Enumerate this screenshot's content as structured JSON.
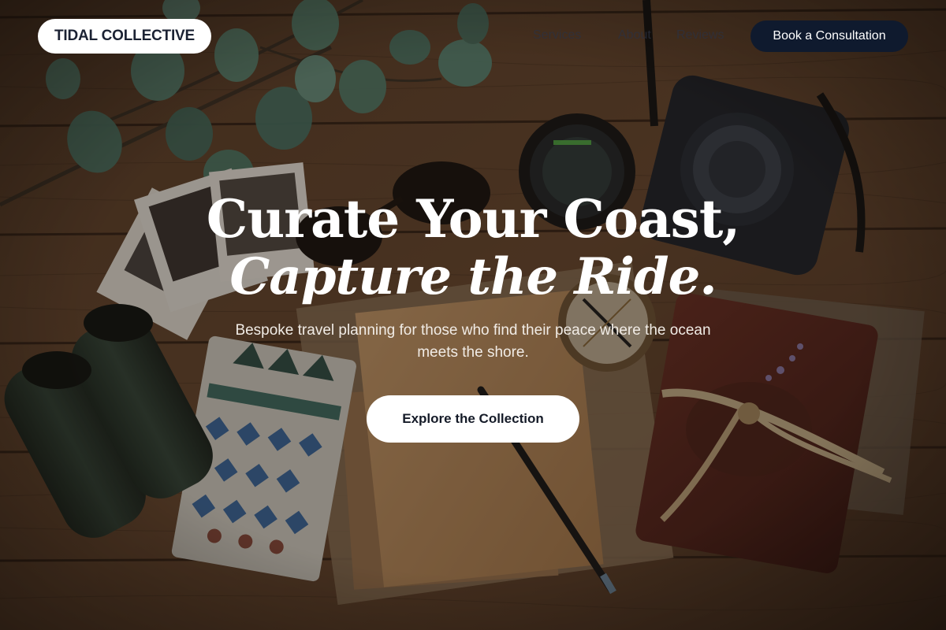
{
  "nav": {
    "logo": "TIDAL COLLECTIVE",
    "links": [
      "Services",
      "About",
      "Reviews"
    ],
    "cta_label": "Book a Consultation"
  },
  "hero": {
    "headline_line1": "Curate Your Coast,",
    "headline_line2": "Capture the Ride.",
    "subtitle": "Bespoke travel planning for those who find their peace where the ocean meets the shore.",
    "cta_label": "Explore the Collection"
  },
  "colors": {
    "nav_cta_bg": "#0f1a2e",
    "pill_bg": "#ffffff",
    "headline": "#ffffff",
    "wood": "#4a3322"
  },
  "background": {
    "icons": [
      "eucalyptus-leaves",
      "instant-photos",
      "sunglasses",
      "camera-lens",
      "mirrorless-camera",
      "compass",
      "binoculars",
      "patterned-notebook",
      "kraft-paper-notepad",
      "pencil",
      "leather-journal",
      "vintage-map"
    ]
  }
}
